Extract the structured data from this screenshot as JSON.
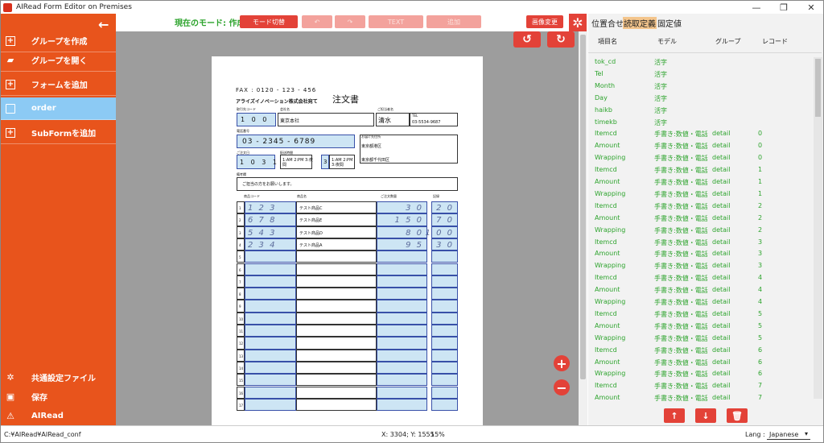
{
  "window": {
    "title": "AIRead Form Editor on Premises"
  },
  "sidebar": {
    "items": [
      {
        "label": "グループを作成",
        "icon": "plus-square-icon"
      },
      {
        "label": "グループを開く",
        "icon": "folder-open-icon"
      },
      {
        "label": "フォームを追加",
        "icon": "plus-square-icon"
      },
      {
        "label": "order",
        "icon": "document-icon"
      },
      {
        "label": "SubFormを追加",
        "icon": "plus-square-icon"
      }
    ],
    "bottom": [
      {
        "label": "共通設定ファイル",
        "icon": "gear-icon"
      },
      {
        "label": "保存",
        "icon": "save-icon"
      },
      {
        "label": "AIRead",
        "icon": "logo-icon"
      }
    ]
  },
  "toolbar": {
    "mode_label": "現在のモード: 作成",
    "mode_switch": "モード切替",
    "undo": "↶",
    "redo": "↷",
    "btn_disabled1": "TEXT",
    "btn_disabled2": "追加",
    "image_change": "画像変更"
  },
  "canvas": {
    "rotate_left": "↺",
    "rotate_right": "↻",
    "zoom_in": "+",
    "zoom_out": "−"
  },
  "sheet": {
    "fax": "FAX : 0120 - 123 - 456",
    "title": "注文書",
    "company": "アライズイノベーション株式会社宛て",
    "code_label": "取引先コード",
    "name_label": "会社名",
    "person_label": "ご担当者名",
    "code_value": "1 0 0",
    "company_value": "東京本社",
    "person_value": "清水",
    "tel_label": "TEL",
    "tel_small": "03-5534-9687",
    "tel_value": "03 - 2345 - 6789",
    "tel_value_label": "電話番号",
    "addr_label": "お届け先住所",
    "addr_value": "東京都港区",
    "addr_value2": "東京都千代田区",
    "date_label": "ご注文日",
    "date_value": "1 0 3 1",
    "time_label": "配送時間",
    "time_options": "1:AM 2:PM 3:夜間",
    "sel_value": "3",
    "comment_label": "備考欄",
    "comment_value": "ご担当の方をお願いします。",
    "col_item": "商品コード",
    "col_name": "商品名",
    "col_qty": "ご注文数量",
    "col_rec": "記録",
    "rows": [
      {
        "no": "1",
        "code": "1 2 3",
        "name": "テスト商品C",
        "qty": "3 0",
        "rec": "2 0"
      },
      {
        "no": "2",
        "code": "6 7 8",
        "name": "テスト商品E",
        "qty": "1 5 0",
        "rec": "7 0"
      },
      {
        "no": "3",
        "code": "5 4 3",
        "name": "テスト商品D",
        "qty": "8 0",
        "rec": "1 0 0"
      },
      {
        "no": "4",
        "code": "2 3 4",
        "name": "テスト商品A",
        "qty": "9 5",
        "rec": "3 0"
      },
      {
        "no": "5",
        "code": "",
        "name": "",
        "qty": "",
        "rec": ""
      },
      {
        "no": "6",
        "code": "",
        "name": "",
        "qty": "",
        "rec": ""
      },
      {
        "no": "7",
        "code": "",
        "name": "",
        "qty": "",
        "rec": ""
      },
      {
        "no": "8",
        "code": "",
        "name": "",
        "qty": "",
        "rec": ""
      },
      {
        "no": "9",
        "code": "",
        "name": "",
        "qty": "",
        "rec": ""
      },
      {
        "no": "10",
        "code": "",
        "name": "",
        "qty": "",
        "rec": ""
      },
      {
        "no": "11",
        "code": "",
        "name": "",
        "qty": "",
        "rec": ""
      },
      {
        "no": "12",
        "code": "",
        "name": "",
        "qty": "",
        "rec": ""
      },
      {
        "no": "13",
        "code": "",
        "name": "",
        "qty": "",
        "rec": ""
      },
      {
        "no": "14",
        "code": "",
        "name": "",
        "qty": "",
        "rec": ""
      },
      {
        "no": "15",
        "code": "",
        "name": "",
        "qty": "",
        "rec": ""
      },
      {
        "no": "16",
        "code": "",
        "name": "",
        "qty": "",
        "rec": ""
      },
      {
        "no": "17",
        "code": "",
        "name": "",
        "qty": "",
        "rec": ""
      }
    ]
  },
  "rpanel": {
    "tabs": [
      "位置合せ",
      "読取定義",
      "固定値"
    ],
    "active_tab": "読取定義",
    "headers": [
      "項目名",
      "モデル",
      "グループ",
      "レコード"
    ],
    "rows": [
      {
        "name": "tok_cd",
        "model": "活字",
        "group": "",
        "record": ""
      },
      {
        "name": "Tel",
        "model": "活字",
        "group": "",
        "record": ""
      },
      {
        "name": "Month",
        "model": "活字",
        "group": "",
        "record": ""
      },
      {
        "name": "Day",
        "model": "活字",
        "group": "",
        "record": ""
      },
      {
        "name": "haikb",
        "model": "活字",
        "group": "",
        "record": ""
      },
      {
        "name": "timekb",
        "model": "活字",
        "group": "",
        "record": ""
      },
      {
        "name": "Itemcd",
        "model": "手書き:数値・電話",
        "group": "detail",
        "record": "0"
      },
      {
        "name": "Amount",
        "model": "手書き:数値・電話",
        "group": "detail",
        "record": "0"
      },
      {
        "name": "Wrapping",
        "model": "手書き:数値・電話",
        "group": "detail",
        "record": "0"
      },
      {
        "name": "Itemcd",
        "model": "手書き:数値・電話",
        "group": "detail",
        "record": "1"
      },
      {
        "name": "Amount",
        "model": "手書き:数値・電話",
        "group": "detail",
        "record": "1"
      },
      {
        "name": "Wrapping",
        "model": "手書き:数値・電話",
        "group": "detail",
        "record": "1"
      },
      {
        "name": "Itemcd",
        "model": "手書き:数値・電話",
        "group": "detail",
        "record": "2"
      },
      {
        "name": "Amount",
        "model": "手書き:数値・電話",
        "group": "detail",
        "record": "2"
      },
      {
        "name": "Wrapping",
        "model": "手書き:数値・電話",
        "group": "detail",
        "record": "2"
      },
      {
        "name": "Itemcd",
        "model": "手書き:数値・電話",
        "group": "detail",
        "record": "3"
      },
      {
        "name": "Amount",
        "model": "手書き:数値・電話",
        "group": "detail",
        "record": "3"
      },
      {
        "name": "Wrapping",
        "model": "手書き:数値・電話",
        "group": "detail",
        "record": "3"
      },
      {
        "name": "Itemcd",
        "model": "手書き:数値・電話",
        "group": "detail",
        "record": "4"
      },
      {
        "name": "Amount",
        "model": "手書き:数値・電話",
        "group": "detail",
        "record": "4"
      },
      {
        "name": "Wrapping",
        "model": "手書き:数値・電話",
        "group": "detail",
        "record": "4"
      },
      {
        "name": "Itemcd",
        "model": "手書き:数値・電話",
        "group": "detail",
        "record": "5"
      },
      {
        "name": "Amount",
        "model": "手書き:数値・電話",
        "group": "detail",
        "record": "5"
      },
      {
        "name": "Wrapping",
        "model": "手書き:数値・電話",
        "group": "detail",
        "record": "5"
      },
      {
        "name": "Itemcd",
        "model": "手書き:数値・電話",
        "group": "detail",
        "record": "6"
      },
      {
        "name": "Amount",
        "model": "手書き:数値・電話",
        "group": "detail",
        "record": "6"
      },
      {
        "name": "Wrapping",
        "model": "手書き:数値・電話",
        "group": "detail",
        "record": "6"
      },
      {
        "name": "Itemcd",
        "model": "手書き:数値・電話",
        "group": "detail",
        "record": "7"
      },
      {
        "name": "Amount",
        "model": "手書き:数値・電話",
        "group": "detail",
        "record": "7"
      }
    ],
    "action_up": "↑",
    "action_down": "↓",
    "action_delete": "🗑"
  },
  "status": {
    "path": "C:¥AIRead¥AIRead_conf",
    "coords": "X: 3304; Y: 1555",
    "zoom": "15%",
    "lang_label": "Lang :",
    "lang_value": "Japanese"
  },
  "colors": {
    "accent": "#e8541c",
    "button": "#e34238",
    "selected": "#8ccaf4",
    "model_text": "#2ea42e"
  }
}
